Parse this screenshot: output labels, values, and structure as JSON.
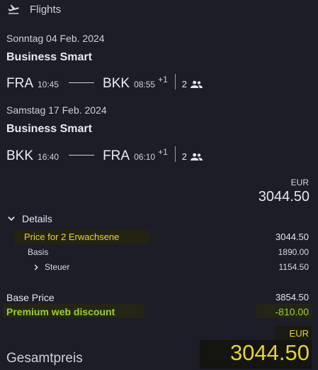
{
  "header": {
    "title": "Flights",
    "icon": "airplane-takeoff-icon"
  },
  "segments": [
    {
      "date": "Sonntag 04 Feb. 2024",
      "cabin": "Business Smart",
      "from": "FRA",
      "dep_time": "10:45",
      "to": "BKK",
      "arr_time": "08:55",
      "day_offset": "+1",
      "passengers": "2"
    },
    {
      "date": "Samstag 17 Feb. 2024",
      "cabin": "Business Smart",
      "from": "BKK",
      "dep_time": "16:40",
      "to": "FRA",
      "arr_time": "06:10",
      "day_offset": "+1",
      "passengers": "2"
    }
  ],
  "total_top": {
    "currency": "EUR",
    "amount": "3044.50"
  },
  "details": {
    "toggle_label": "Details",
    "price_for_label": "Price for 2 Erwachsene",
    "price_for_value": "3044.50",
    "basis_label": "Basis",
    "basis_value": "1890.00",
    "tax_label": "Steuer",
    "tax_value": "1154.50"
  },
  "base_price": {
    "label": "Base Price",
    "value": "3854.50"
  },
  "discount": {
    "label": "Premium web discount",
    "value": "-810.00"
  },
  "grand_total": {
    "label": "Gesamtpreis",
    "currency": "EUR",
    "amount": "3044.50"
  },
  "colors": {
    "background": "#1c1d27",
    "highlight_yellow": "#e8d233",
    "discount_green": "#9bd22b"
  }
}
